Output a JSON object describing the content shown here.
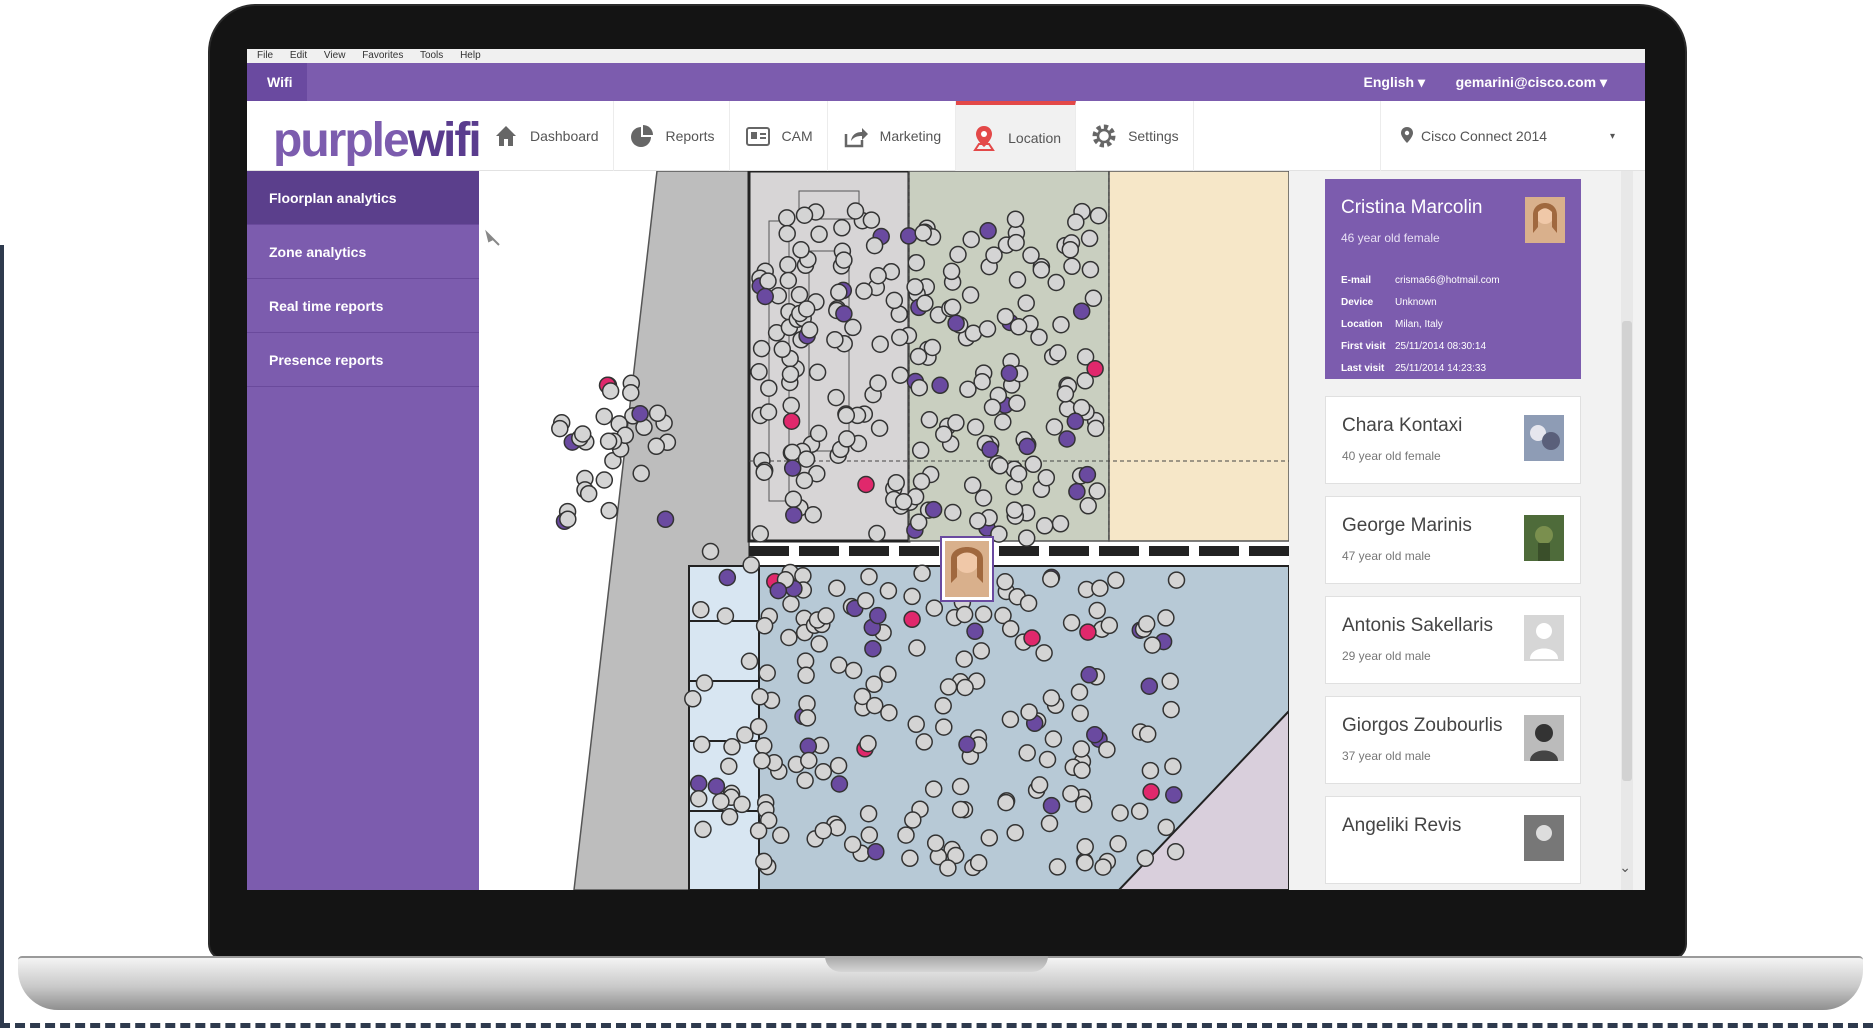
{
  "browser_menu": [
    "File",
    "Edit",
    "View",
    "Favorites",
    "Tools",
    "Help"
  ],
  "topbar": {
    "tab_label": "Wifi",
    "language": "English ▾",
    "user": "gemarini@cisco.com ▾"
  },
  "logo": {
    "part1": "purple",
    "part2": "wifi"
  },
  "nav": {
    "items": [
      {
        "label": "Dashboard",
        "icon": "home-icon"
      },
      {
        "label": "Reports",
        "icon": "pie-chart-icon"
      },
      {
        "label": "CAM",
        "icon": "id-card-icon"
      },
      {
        "label": "Marketing",
        "icon": "share-icon"
      },
      {
        "label": "Location",
        "icon": "map-pin-icon"
      },
      {
        "label": "Settings",
        "icon": "gear-icon"
      }
    ],
    "active": "Location",
    "active_color": "#e34848"
  },
  "venue": {
    "label": "Cisco Connect 2014",
    "icon": "location-marker-icon"
  },
  "sidebar": {
    "items": [
      {
        "label": "Floorplan analytics"
      },
      {
        "label": "Zone analytics"
      },
      {
        "label": "Real time reports"
      },
      {
        "label": "Presence reports"
      }
    ],
    "active": "Floorplan analytics"
  },
  "map": {
    "marker_colors": {
      "visitor": "#d4d4d4",
      "returning": "#6a4aa0",
      "highlight": "#e0286c"
    }
  },
  "people": {
    "featured": {
      "name": "Cristina Marcolin",
      "sub": "46 year old female",
      "details": [
        {
          "label": "E-mail",
          "value": "crisma66@hotmail.com"
        },
        {
          "label": "Device",
          "value": "Unknown"
        },
        {
          "label": "Location",
          "value": "Milan, Italy"
        },
        {
          "label": "First visit",
          "value": "25/11/2014 08:30:14"
        },
        {
          "label": "Last visit",
          "value": "25/11/2014 14:23:33"
        }
      ]
    },
    "list": [
      {
        "name": "Chara Kontaxi",
        "sub": "40 year old female"
      },
      {
        "name": "George Marinis",
        "sub": "47 year old male"
      },
      {
        "name": "Antonis Sakellaris",
        "sub": "29 year old male"
      },
      {
        "name": "Giorgos Zoubourlis",
        "sub": "37 year old male"
      },
      {
        "name": "Angeliki Revis",
        "sub": ""
      }
    ]
  },
  "colors": {
    "brand_purple": "#7c5cae",
    "brand_dark": "#5b3f8c"
  }
}
